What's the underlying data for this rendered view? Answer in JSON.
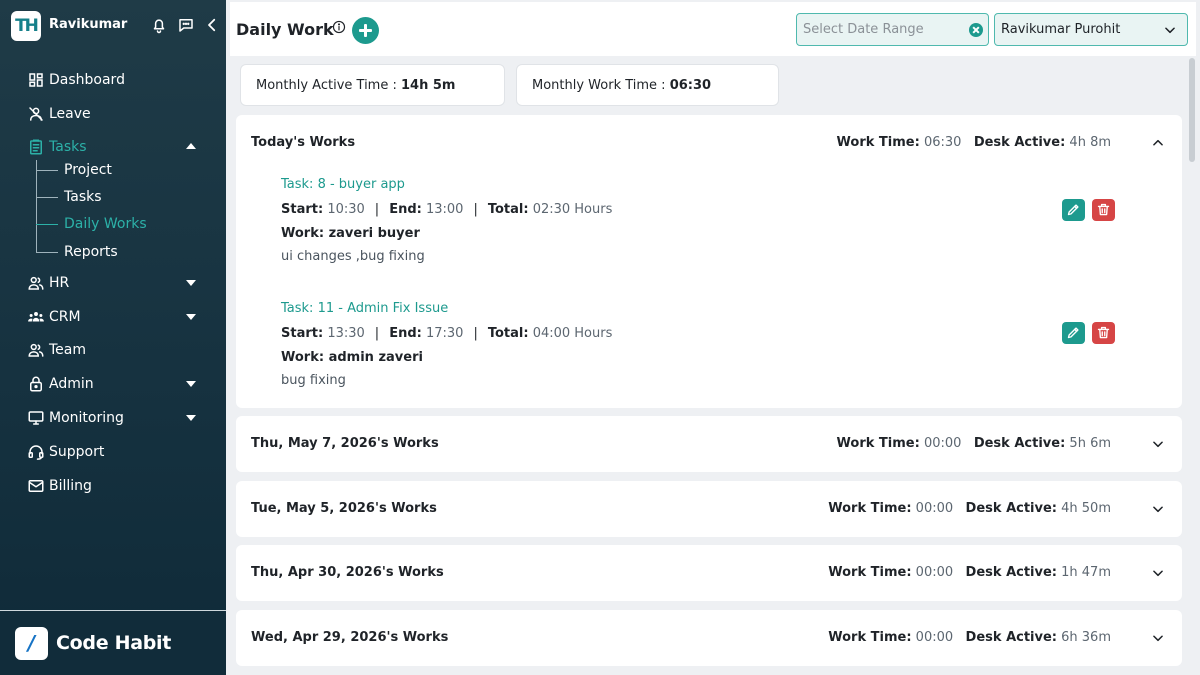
{
  "sidebar": {
    "logo_text": "TH",
    "user_name": "Ravikumar",
    "nav": [
      {
        "label": "Dashboard",
        "icon": "dashboard-icon"
      },
      {
        "label": "Leave",
        "icon": "leave-icon"
      },
      {
        "label": "Tasks",
        "icon": "tasks-icon",
        "expanded": true,
        "active": true
      },
      {
        "label": "HR",
        "icon": "hr-icon",
        "has_submenu": true
      },
      {
        "label": "CRM",
        "icon": "crm-icon",
        "has_submenu": true
      },
      {
        "label": "Team",
        "icon": "team-icon"
      },
      {
        "label": "Admin",
        "icon": "admin-lock-icon",
        "has_submenu": true
      },
      {
        "label": "Monitoring",
        "icon": "monitor-icon",
        "has_submenu": true
      },
      {
        "label": "Support",
        "icon": "support-icon"
      },
      {
        "label": "Billing",
        "icon": "billing-icon"
      }
    ],
    "task_submenu": [
      {
        "label": "Project"
      },
      {
        "label": "Tasks"
      },
      {
        "label": "Daily Works",
        "active": true
      },
      {
        "label": "Reports"
      }
    ],
    "brand_icon_text": "/",
    "brand_name": "Code Habit"
  },
  "header": {
    "title": "Daily Work",
    "date_range_placeholder": "Select Date Range",
    "selected_user": "Ravikumar Purohit"
  },
  "stats": {
    "monthly_active_label": "Monthly Active Time : ",
    "monthly_active_value": "14h 5m",
    "monthly_work_label": "Monthly Work Time : ",
    "monthly_work_value": "06:30"
  },
  "labels": {
    "work_time": "Work Time:",
    "desk_active": "Desk Active:",
    "start": "Start:",
    "end": "End:",
    "total": "Total:",
    "separator": "|"
  },
  "today": {
    "title": "Today's Works",
    "work_time": "06:30",
    "desk_active": "4h 8m",
    "tasks": [
      {
        "name": "Task: 8 - buyer app",
        "start": "10:30",
        "end": "13:00",
        "total": "02:30 Hours",
        "work": "Work: zaveri buyer",
        "desc": "ui changes ,bug fixing"
      },
      {
        "name": "Task: 11 - Admin Fix Issue",
        "start": "13:30",
        "end": "17:30",
        "total": "04:00 Hours",
        "work": "Work: admin zaveri",
        "desc": "bug fixing"
      }
    ]
  },
  "days": [
    {
      "title": "Thu, May 7, 2026's Works",
      "work_time": "00:00",
      "desk_active": "5h 6m"
    },
    {
      "title": "Tue, May 5, 2026's Works",
      "work_time": "00:00",
      "desk_active": "4h 50m"
    },
    {
      "title": "Thu, Apr 30, 2026's Works",
      "work_time": "00:00",
      "desk_active": "1h 47m"
    },
    {
      "title": "Wed, Apr 29, 2026's Works",
      "work_time": "00:00",
      "desk_active": "6h 36m"
    }
  ],
  "colors": {
    "accent": "#1d9a8e",
    "danger": "#d64545",
    "sidebar_bg": "#163240"
  }
}
